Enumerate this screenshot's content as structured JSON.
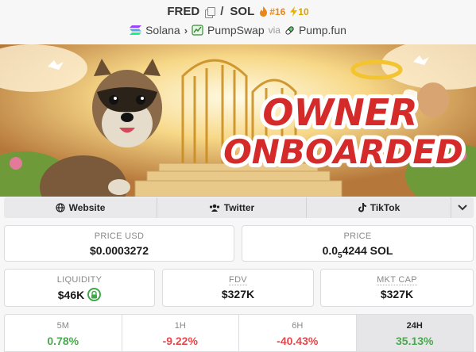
{
  "header": {
    "token": "FRED",
    "quote": "SOL",
    "slash": "/",
    "rank": "#16",
    "boosts": "10",
    "chain": "Solana",
    "dex": "PumpSwap",
    "via": "via",
    "launchpad": "Pump.fun"
  },
  "banner": {
    "line1": "OWNER",
    "line2": "ONBOARDED"
  },
  "socials": {
    "website": "Website",
    "twitter": "Twitter",
    "tiktok": "TikTok"
  },
  "stats": {
    "price_usd_label": "PRICE USD",
    "price_usd": "$0.0003272",
    "price_label": "PRICE",
    "price_prefix": "0.0",
    "price_sub": "5",
    "price_suffix": "4244 SOL",
    "liquidity_label": "LIQUIDITY",
    "liquidity": "$46K",
    "fdv_label": "FDV",
    "fdv": "$327K",
    "mktcap_label": "MKT CAP",
    "mktcap": "$327K"
  },
  "timeframes": [
    {
      "label": "5M",
      "value": "0.78%"
    },
    {
      "label": "1H",
      "value": "-9.22%"
    },
    {
      "label": "6H",
      "value": "-40.43%"
    },
    {
      "label": "24H",
      "value": "35.13%"
    }
  ],
  "colors": {
    "positive": "#4aa84f",
    "negative": "#e5484d",
    "rank": "#e8871a",
    "boost": "#d9a300"
  }
}
